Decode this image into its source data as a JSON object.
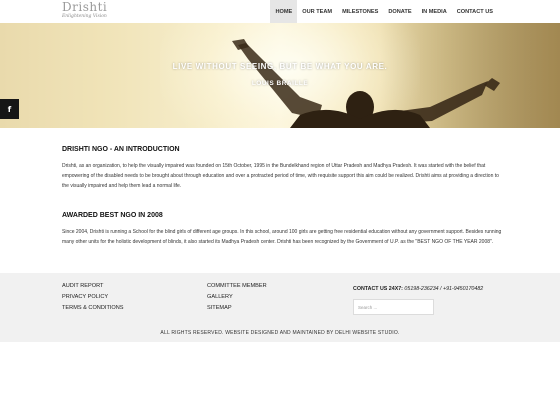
{
  "header": {
    "logo_text": "Drishti",
    "logo_tagline": "Enlightening Vision",
    "nav": [
      "HOME",
      "OUR TEAM",
      "MILESTONES",
      "DONATE",
      "IN MEDIA",
      "CONTACT US"
    ],
    "active_nav": "HOME"
  },
  "hero": {
    "quote": "LIVE WITHOUT SEEING, BUT BE WHAT YOU ARE.",
    "author": "LOUIS BRAILLE"
  },
  "social": {
    "facebook_glyph": "f",
    "icon": "facebook-icon"
  },
  "intro": {
    "title": "DRISHTI NGO - AN INTRODUCTION",
    "text": "Drishti, as an organization, to help the visually impaired was founded on 15th October, 1995 in the Bundelkhand region of Uttar Pradesh and Madhya Pradesh. It was started with the belief that empowering of the disabled needs to be brought about through education and over a protracted period of time, with requisite support this aim could be realized. Drishti aims at providing a direction to the visually impaired and help them lead a normal life."
  },
  "award": {
    "title": "AWARDED BEST NGO IN 2008",
    "text": "Since 2004, Drishti is running a School for the blind girls of different age groups. In this school, around 100 girls are getting free residential education without any government support. Besides running many other units for the holistic development of blinds, it also started its Madhya Pradesh center. Drishti has been recognized by the Government of U.P. as the \"BEST NGO OF THE YEAR 2008\"."
  },
  "footer": {
    "col1": [
      "AUDIT REPORT",
      "PRIVACY POLICY",
      "TERMS & CONDITIONS"
    ],
    "col2": [
      "COMMITTEE MEMBER",
      "GALLERY",
      "SITEMAP"
    ],
    "contact_label": "CONTACT US 24X7:",
    "contact_numbers": "05198-236234 / +91-9450170482",
    "search_placeholder": "Search ...",
    "copyright": "ALL RIGHTS RESERVED. WEBSITE DESIGNED AND MAINTAINED BY DELHI WEBSITE STUDIO."
  },
  "colors": {
    "nav_active_bg": "#e6e6e6",
    "footer_bg": "#f1f1f1",
    "fb_tab_bg": "#161616",
    "hero_gold": "#e2cd92"
  }
}
